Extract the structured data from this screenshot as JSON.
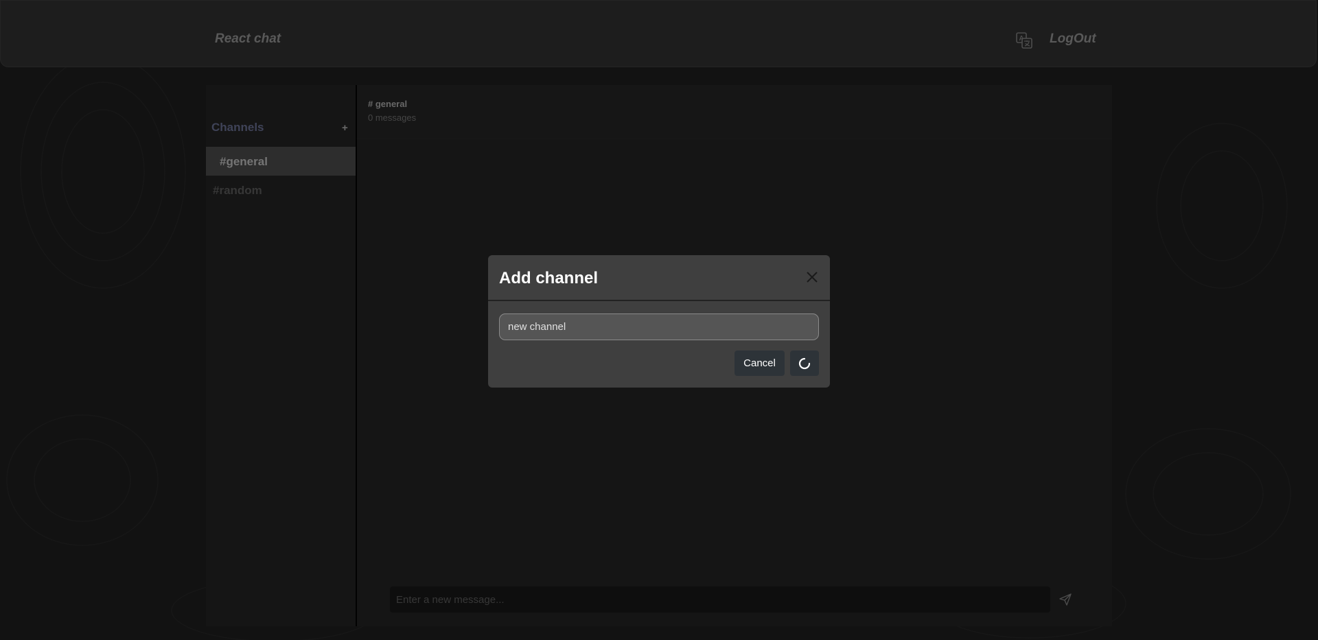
{
  "navbar": {
    "brand": "React chat",
    "language_icon": "translate-icon",
    "logout_label": "LogOut"
  },
  "sidebar": {
    "title": "Channels",
    "add_label": "+",
    "channels": [
      {
        "label": "#general",
        "active": true
      },
      {
        "label": "#random",
        "active": false
      }
    ]
  },
  "chat": {
    "title": "# general",
    "message_count": "0 messages",
    "input_placeholder": "Enter a new message...",
    "send_icon": "send-icon"
  },
  "modal": {
    "title": "Add channel",
    "input_value": "new channel",
    "cancel_label": "Cancel",
    "submit_icon": "spinner-icon",
    "close_icon": "close-icon"
  },
  "colors": {
    "background": "#242424",
    "accent": "#7f86b0",
    "button": "#2d3338"
  }
}
